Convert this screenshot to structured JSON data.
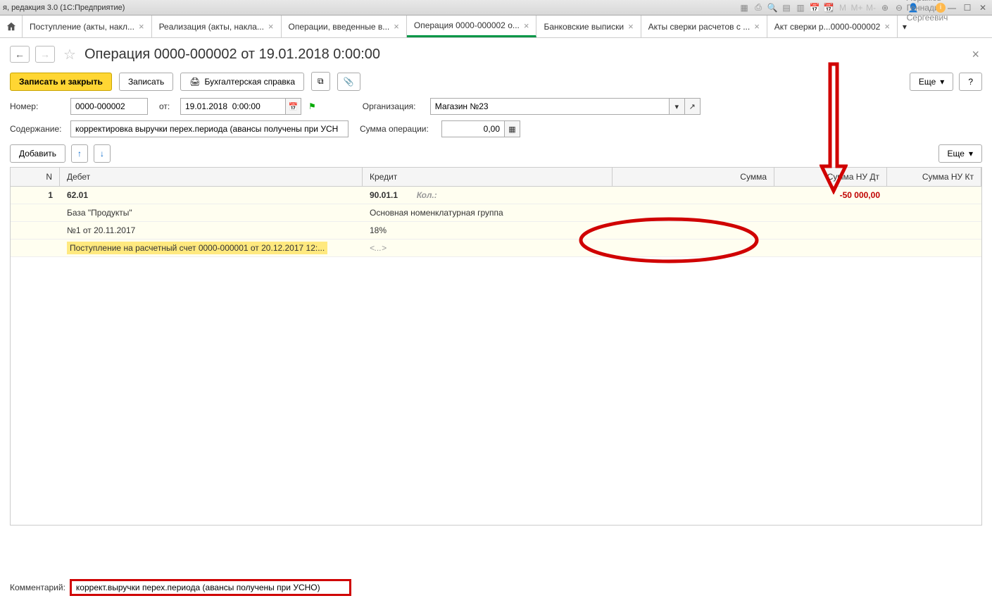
{
  "titlebar": {
    "title": "я, редакция 3.0  (1С:Предприятие)",
    "user": "Абрамов Геннадий Сергеевич"
  },
  "tabs": {
    "items": [
      {
        "label": "Поступление (акты, накл..."
      },
      {
        "label": "Реализация (акты, накла..."
      },
      {
        "label": "Операции, введенные в..."
      },
      {
        "label": "Операция 0000-000002 о..."
      },
      {
        "label": "Банковские выписки"
      },
      {
        "label": "Акты сверки расчетов с ..."
      },
      {
        "label": "Акт сверки р...0000-000002"
      }
    ]
  },
  "header": {
    "title": "Операция 0000-000002 от 19.01.2018 0:00:00"
  },
  "actions": {
    "save_close": "Записать и закрыть",
    "save": "Записать",
    "accounting_ref": "Бухгалтерская справка",
    "more": "Еще",
    "help": "?"
  },
  "form": {
    "number_label": "Номер:",
    "number_value": "0000-000002",
    "from_label": "от:",
    "date_value": "19.01.2018  0:00:00",
    "org_label": "Организация:",
    "org_value": "Магазин №23",
    "content_label": "Содержание:",
    "content_value": "корректировка выручки перех.периода (авансы получены при УСН",
    "opsum_label": "Сумма операции:",
    "opsum_value": "0,00"
  },
  "table": {
    "add_btn": "Добавить",
    "more_btn": "Еще",
    "headers": {
      "n": "N",
      "debit": "Дебет",
      "credit": "Кредит",
      "sum": "Сумма",
      "sumdt": "Сумма НУ Дт",
      "sumkt": "Сумма НУ Кт"
    },
    "rows": [
      {
        "n": "1",
        "debit": "62.01",
        "credit": "90.01.1",
        "credit_extra": "Кол.:",
        "sumdt": "-50 000,00"
      },
      {
        "debit": "База \"Продукты\"",
        "credit": "Основная номенклатурная группа"
      },
      {
        "debit": "№1 от 20.11.2017",
        "credit": "18%"
      },
      {
        "debit": "Поступление на расчетный счет 0000-000001 от 20.12.2017 12:...",
        "credit": "<...>",
        "highlight": true
      }
    ]
  },
  "comment": {
    "label": "Комментарий:",
    "value": "коррект.выручки перех.периода (авансы получены при УСНО)"
  }
}
